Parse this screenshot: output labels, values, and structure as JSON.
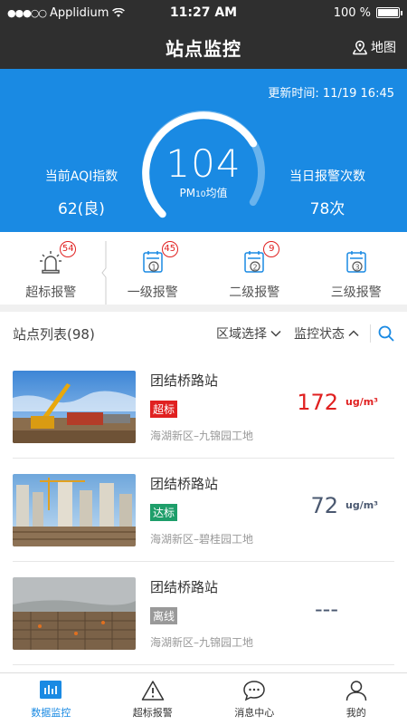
{
  "status_bar": {
    "carrier": "Applidium",
    "time": "11:27 AM",
    "battery": "100 %"
  },
  "nav": {
    "title": "站点监控",
    "map_label": "地图"
  },
  "hero": {
    "update_time": "更新时间: 11/19 16:45",
    "aqi_value": "104",
    "aqi_caption": "PM10均值",
    "left_label": "当前AQI指数",
    "left_value": "62(良)",
    "right_label": "当日报警次数",
    "right_value": "78次",
    "gauge_fraction": 0.72
  },
  "alarms": [
    {
      "label": "超标报警",
      "count": "54",
      "icon": "siren-icon"
    },
    {
      "label": "一级报警",
      "count": "45",
      "icon": "level-1-icon"
    },
    {
      "label": "二级报警",
      "count": "9",
      "icon": "level-2-icon"
    },
    {
      "label": "三级报警",
      "count": "",
      "icon": "level-3-icon"
    }
  ],
  "list": {
    "title": "站点列表(98)",
    "region_filter": "区域选择",
    "status_filter": "监控状态"
  },
  "stations": [
    {
      "name": "团结桥路站",
      "tag": "超标",
      "tag_color": "#e02020",
      "area": "海湖新区–九锦园工地",
      "value": "172",
      "value_color": "#e02020",
      "unit": "ug/m³",
      "unit_color": "#e02020"
    },
    {
      "name": "团结桥路站",
      "tag": "达标",
      "tag_color": "#1e9e6a",
      "area": "海湖新区–碧桂园工地",
      "value": "72",
      "value_color": "#4a5870",
      "unit": "ug/m³",
      "unit_color": "#4a5870"
    },
    {
      "name": "团结桥路站",
      "tag": "离线",
      "tag_color": "#999999",
      "area": "海湖新区–九锦园工地",
      "value": "---",
      "value_color": "#4a5870",
      "unit": "",
      "unit_color": "#4a5870"
    }
  ],
  "tabs": [
    {
      "label": "数据监控",
      "icon": "chart-icon",
      "active": true
    },
    {
      "label": "超标报警",
      "icon": "warning-icon",
      "active": false
    },
    {
      "label": "消息中心",
      "icon": "message-icon",
      "active": false
    },
    {
      "label": "我的",
      "icon": "user-icon",
      "active": false
    }
  ]
}
